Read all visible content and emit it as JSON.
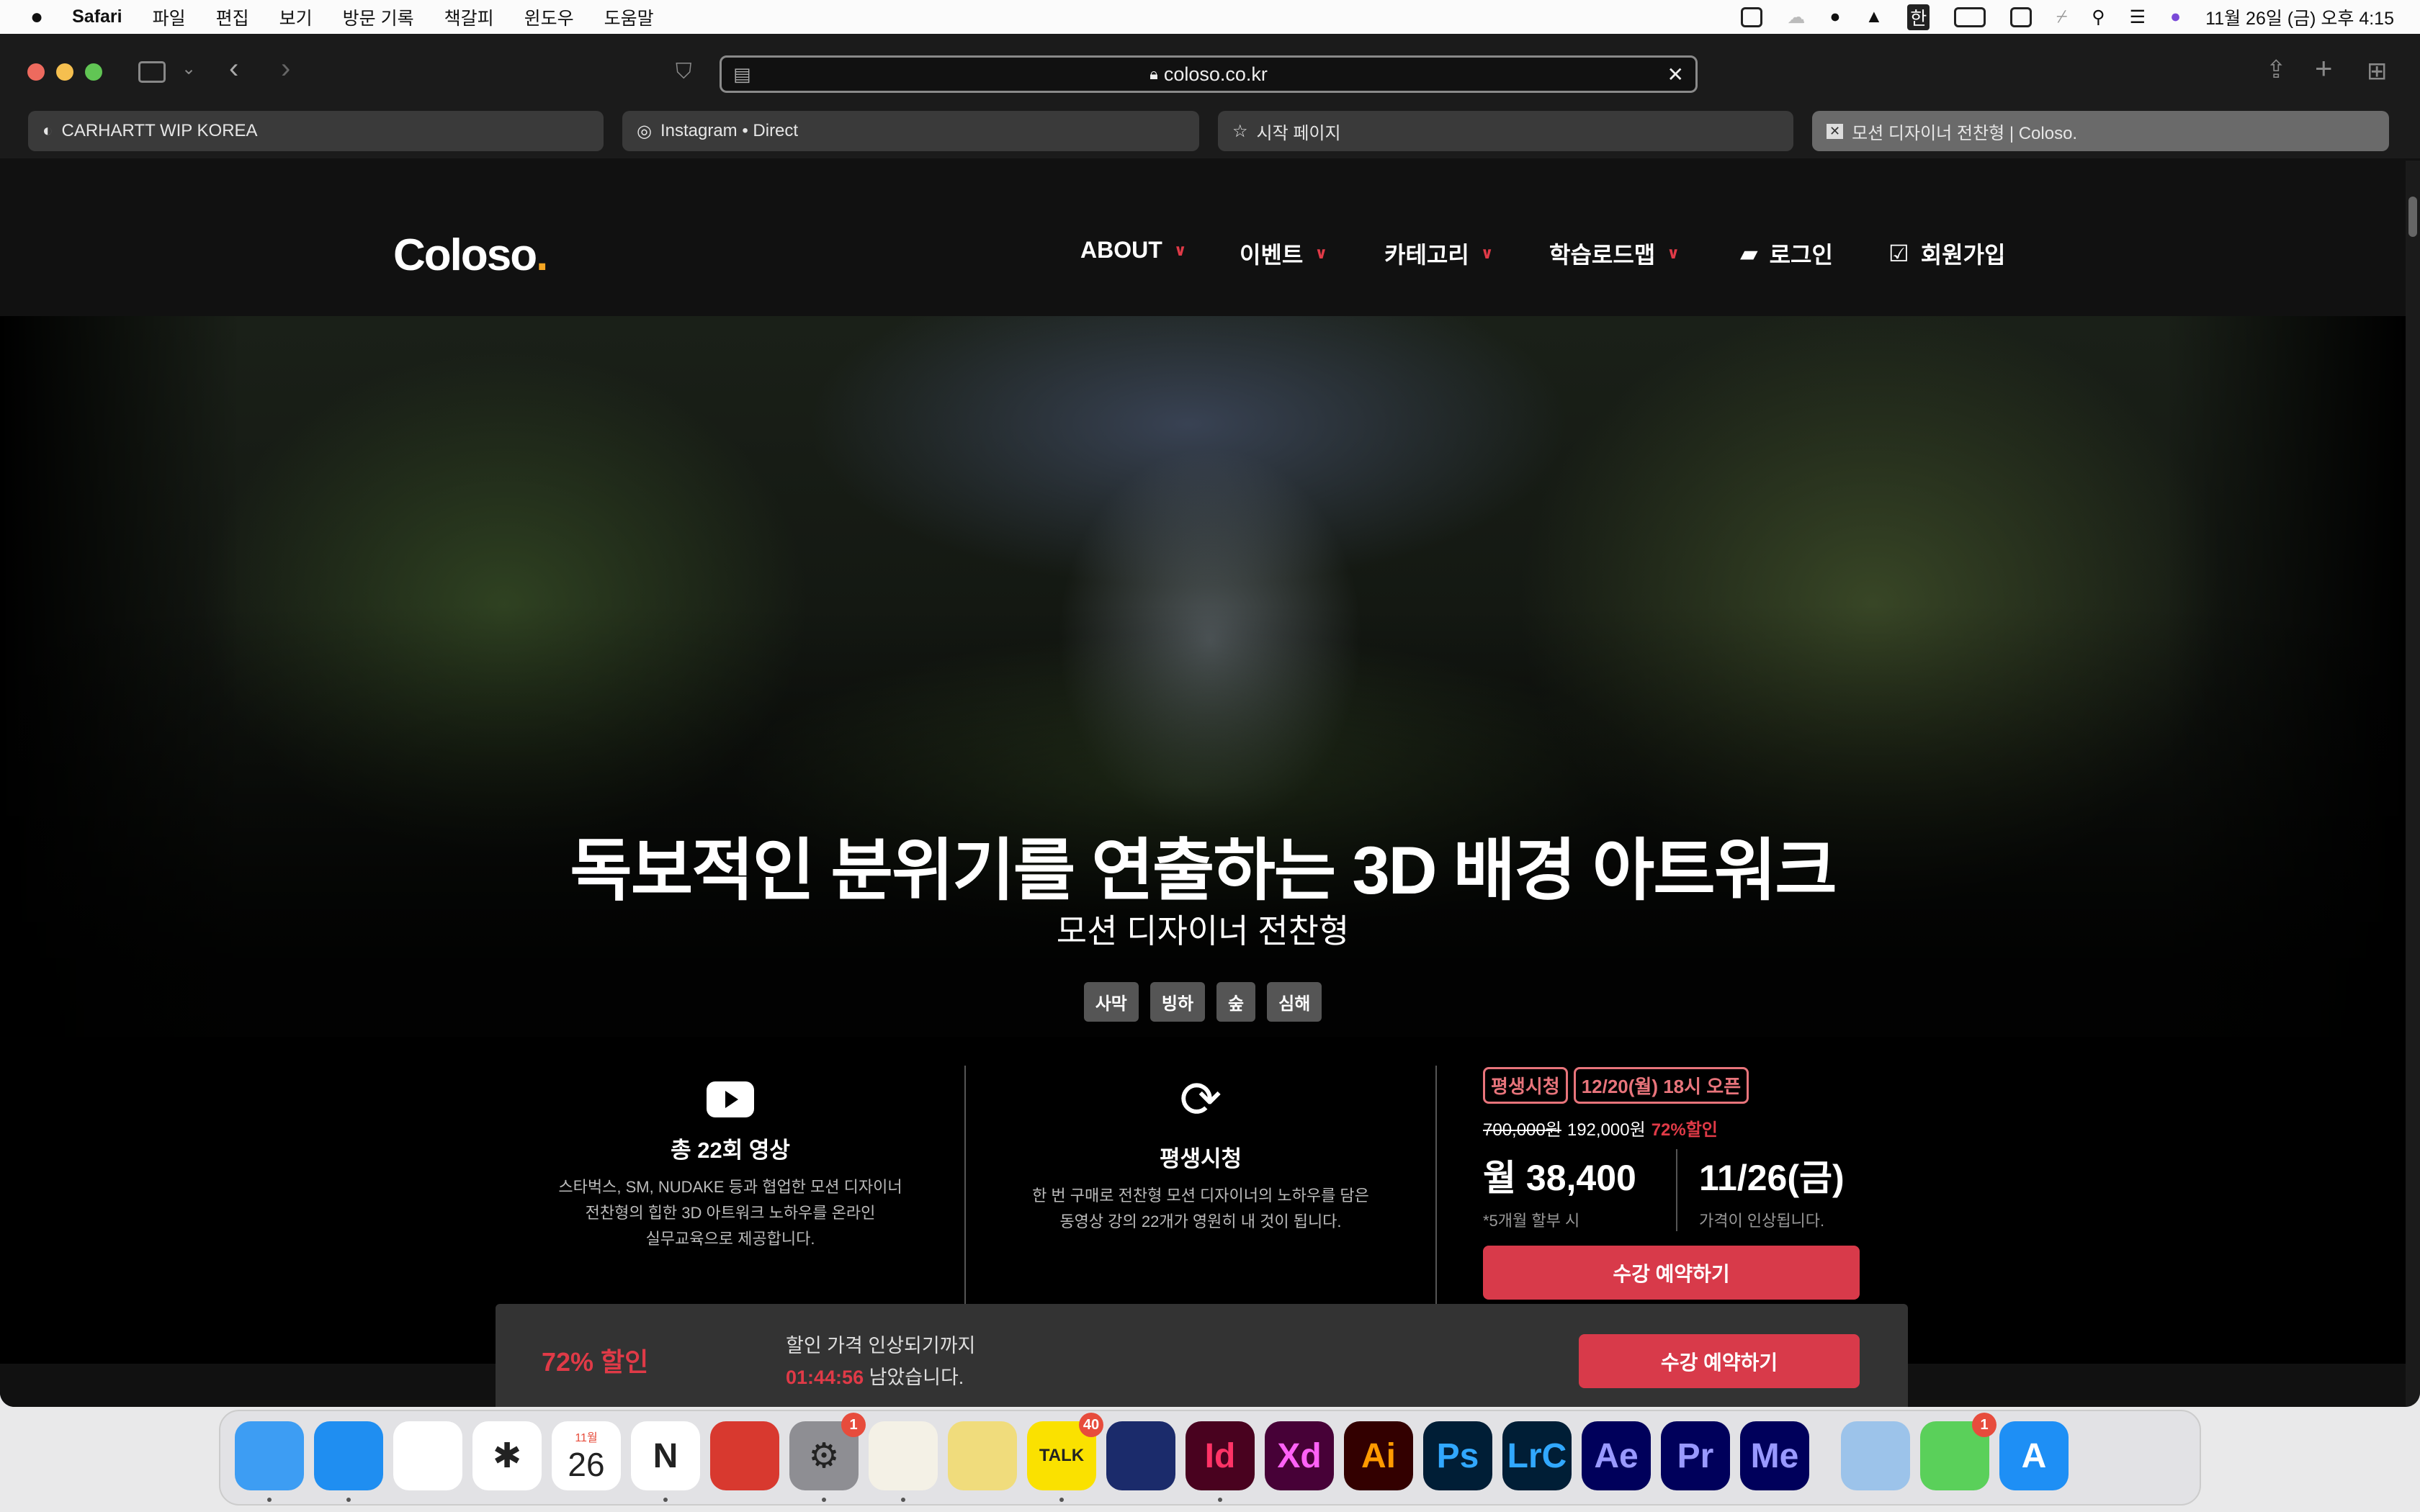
{
  "menubar": {
    "app": "Safari",
    "items": [
      "파일",
      "편집",
      "보기",
      "방문 기록",
      "책갈피",
      "윈도우",
      "도움말"
    ],
    "clock": "11월 26일 (금) 오후 4:15",
    "ime": "한"
  },
  "browser": {
    "url": "coloso.co.kr",
    "tabs": [
      {
        "label": "CARHARTT WIP KOREA",
        "icon": "carhartt-icon"
      },
      {
        "label": "Instagram • Direct",
        "icon": "instagram-icon"
      },
      {
        "label": "시작 페이지",
        "icon": "star-icon"
      },
      {
        "label": "모션 디자이너 전찬형 | Coloso.",
        "icon": "coloso-icon",
        "active": true
      }
    ]
  },
  "site": {
    "logo": "Coloso",
    "logo_dot": ".",
    "nav": [
      {
        "label": "ABOUT"
      },
      {
        "label": "이벤트"
      },
      {
        "label": "카테고리"
      },
      {
        "label": "학습로드맵"
      }
    ],
    "login": "로그인",
    "signup": "회원가입",
    "accent": "#d83a4a"
  },
  "hero": {
    "title": "독보적인 분위기를 연출하는 3D 배경 아트워크",
    "subtitle": "모션 디자이너 전찬형",
    "tags": [
      "사막",
      "빙하",
      "숲",
      "심해"
    ]
  },
  "info": {
    "videos": {
      "title": "총 22회 영상",
      "desc": [
        "스타벅스, SM, NUDAKE 등과 협업한 모션 디자이너",
        "전찬형의 힙한 3D 아트워크 노하우를 온라인",
        "실무교육으로 제공합니다."
      ]
    },
    "lifetime": {
      "title": "평생시청",
      "desc": [
        "한 번 구매로 전찬형 모션 디자이너의 노하우를 담은",
        "동영상 강의 22개가 영원히 내 것이 됩니다."
      ]
    },
    "price": {
      "badges": [
        "평생시청",
        "12/20(월) 18시 오픈"
      ],
      "original": "700,000원",
      "sale": "192,000원",
      "discount": "72%할인",
      "monthly": "월 38,400",
      "monthly_note": "*5개월 할부 시",
      "date": "11/26(금)",
      "date_note": "가격이 인상됩니다.",
      "cta": "수강 예약하기"
    }
  },
  "sticky": {
    "discount": "72% 할인",
    "line1": "할인 가격 인상되기까지",
    "countdown": "01:44:56",
    "line2": " 남았습니다.",
    "cta": "수강 예약하기"
  },
  "dock": {
    "apps": [
      {
        "name": "Finder",
        "label": "",
        "bg": "#3d9df3"
      },
      {
        "name": "Safari",
        "label": "",
        "bg": "#1f8ef1"
      },
      {
        "name": "Chrome",
        "label": "",
        "bg": "#fff"
      },
      {
        "name": "Craft",
        "label": "✱",
        "bg": "#fff"
      },
      {
        "name": "Calendar",
        "label": "26",
        "month": "11월",
        "bg": "#fff"
      },
      {
        "name": "Notion",
        "label": "N",
        "bg": "#fff"
      },
      {
        "name": "Photo Booth",
        "label": "",
        "bg": "#d8392f"
      },
      {
        "name": "System Preferences",
        "label": "⚙",
        "bg": "#8e8e93",
        "badge": "1"
      },
      {
        "name": "Notes",
        "label": "",
        "bg": "#f4f1e6"
      },
      {
        "name": "Stickies",
        "label": "",
        "bg": "#f0dc7c"
      },
      {
        "name": "KakaoTalk",
        "label": "TALK",
        "bg": "#fae100",
        "badge": "40"
      },
      {
        "name": "Cinema 4D",
        "label": "",
        "bg": "#1b2b6b"
      },
      {
        "name": "InDesign",
        "label": "Id",
        "bg": "#49021f",
        "fg": "#ff3366"
      },
      {
        "name": "XD",
        "label": "Xd",
        "bg": "#470137",
        "fg": "#ff61f6"
      },
      {
        "name": "Illustrator",
        "label": "Ai",
        "bg": "#330000",
        "fg": "#ff9a00"
      },
      {
        "name": "Photoshop",
        "label": "Ps",
        "bg": "#001e36",
        "fg": "#31a8ff"
      },
      {
        "name": "Lightroom Classic",
        "label": "LrC",
        "bg": "#001e36",
        "fg": "#31a8ff"
      },
      {
        "name": "After Effects",
        "label": "Ae",
        "bg": "#00005b",
        "fg": "#9999ff"
      },
      {
        "name": "Premiere Pro",
        "label": "Pr",
        "bg": "#00005b",
        "fg": "#9999ff"
      },
      {
        "name": "Media Encoder",
        "label": "Me",
        "bg": "#00005b",
        "fg": "#9999ff"
      },
      {
        "name": "Preview",
        "label": "",
        "bg": "#9cc3ea"
      },
      {
        "name": "FaceTime",
        "label": "",
        "bg": "#5ad05a",
        "badge": "1"
      },
      {
        "name": "App Store",
        "label": "A",
        "bg": "#1e8ff5",
        "fg": "#fff"
      },
      {
        "name": "Trash",
        "label": "",
        "bg": "transparent"
      }
    ]
  }
}
